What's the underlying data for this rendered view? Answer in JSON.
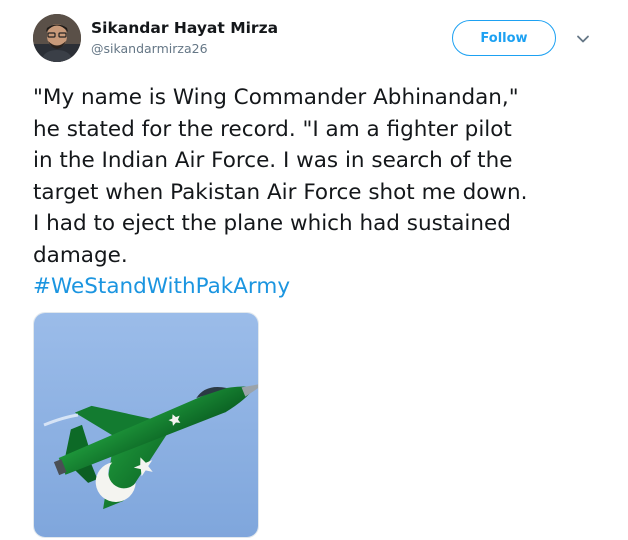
{
  "tweet": {
    "author": {
      "display_name": "Sikandar Hayat Mirza",
      "handle": "@sikandarmirza26"
    },
    "follow_label": "Follow",
    "text_lines": [
      "\"My name is Wing Commander Abhinandan,\"",
      "he stated for the record. \"I am a fighter pilot",
      "in the Indian Air Force. I was in search of the",
      "target when Pakistan Air Force shot me down.",
      "I had to eject the plane which had sustained",
      "damage."
    ],
    "hashtag": "#WeStandWithPakArmy",
    "icons": {
      "caret": "chevron-down-icon"
    },
    "colors": {
      "accent": "#1da1f2",
      "hashtag": "#1b95e0",
      "text": "#14171a",
      "secondary": "#657786",
      "jet_green": "#0f7a2a",
      "sky": "#8fb3e3"
    }
  }
}
